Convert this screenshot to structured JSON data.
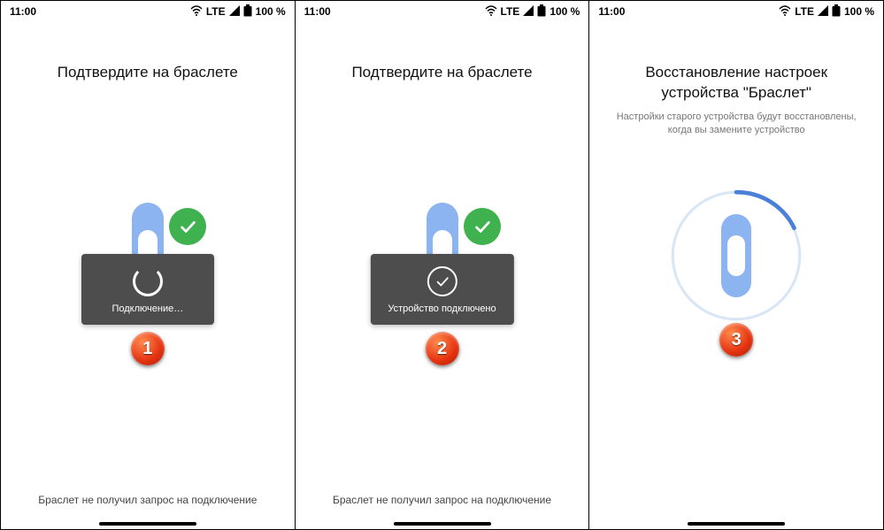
{
  "status": {
    "time": "11:00",
    "network": "LTE",
    "battery": "100 %"
  },
  "panel1": {
    "title": "Подтвердите на браслете",
    "toast": "Подключение…",
    "footer": "Браслет не получил запрос на подключение",
    "step": "1"
  },
  "panel2": {
    "title": "Подтвердите на браслете",
    "toast": "Устройство подключено",
    "footer": "Браслет не получил запрос на подключение",
    "step": "2"
  },
  "panel3": {
    "title": "Восстановление настроек устройства \"Браслет\"",
    "subtitle": "Настройки старого устройства будут восстановлены, когда вы замените устройство",
    "step": "3"
  }
}
